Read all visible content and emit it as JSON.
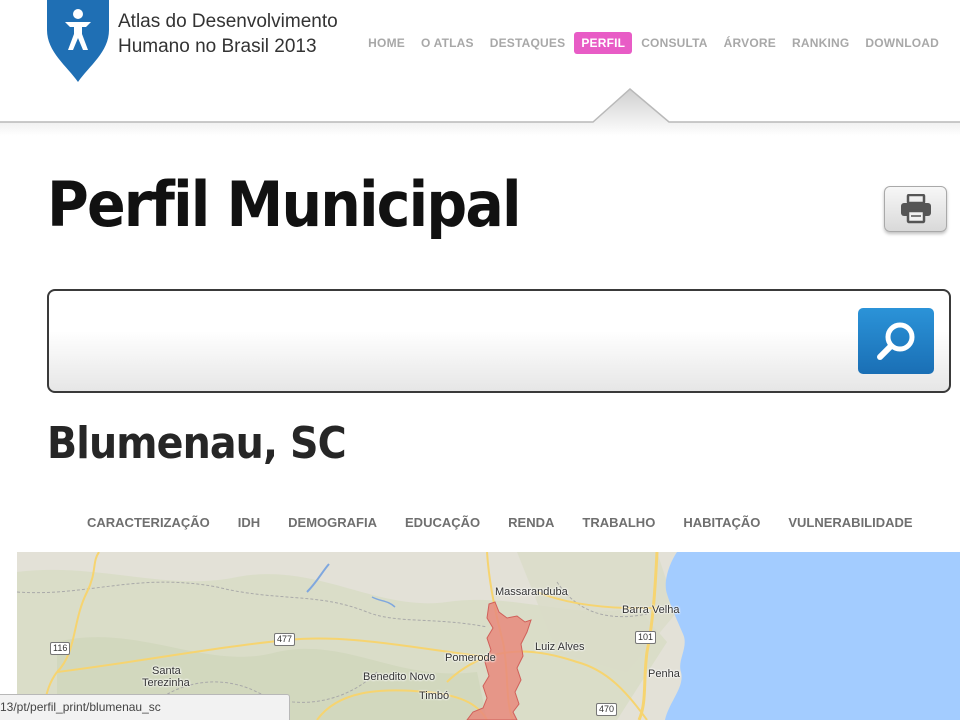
{
  "header": {
    "logo_line1": "Atlas do Desenvolvimento",
    "logo_line2": "Humano no Brasil 2013",
    "nav": [
      {
        "label": "HOME",
        "active": false
      },
      {
        "label": "O ATLAS",
        "active": false
      },
      {
        "label": "DESTAQUES",
        "active": false
      },
      {
        "label": "PERFIL",
        "active": true
      },
      {
        "label": "CONSULTA",
        "active": false
      },
      {
        "label": "ÁRVORE",
        "active": false
      },
      {
        "label": "RANKING",
        "active": false
      },
      {
        "label": "DOWNLOAD",
        "active": false
      }
    ],
    "accent_color": "#e85cc6",
    "logo_color": "#1f6fb4"
  },
  "main": {
    "title": "Perfil Municipal",
    "print_icon": "printer-icon",
    "search": {
      "value": "",
      "placeholder": "",
      "icon": "search-icon",
      "button_color": "#1f80c8"
    },
    "municipality": "Blumenau, SC",
    "sections": [
      "CARACTERIZAÇÃO",
      "IDH",
      "DEMOGRAFIA",
      "EDUCAÇÃO",
      "RENDA",
      "TRABALHO",
      "HABITAÇÃO",
      "VULNERABILIDADE"
    ]
  },
  "map": {
    "places": [
      "Massaranduba",
      "Barra Velha",
      "Luiz Alves",
      "Pomerode",
      "Santa",
      "Terezinha",
      "Benedito Novo",
      "Timbó",
      "Penha"
    ],
    "road_shields": [
      "116",
      "477",
      "101",
      "470"
    ],
    "highlight_color": "#e88a7c",
    "water_color": "#a3ccff"
  },
  "status_bar": {
    "url": "13/pt/perfil_print/blumenau_sc"
  }
}
